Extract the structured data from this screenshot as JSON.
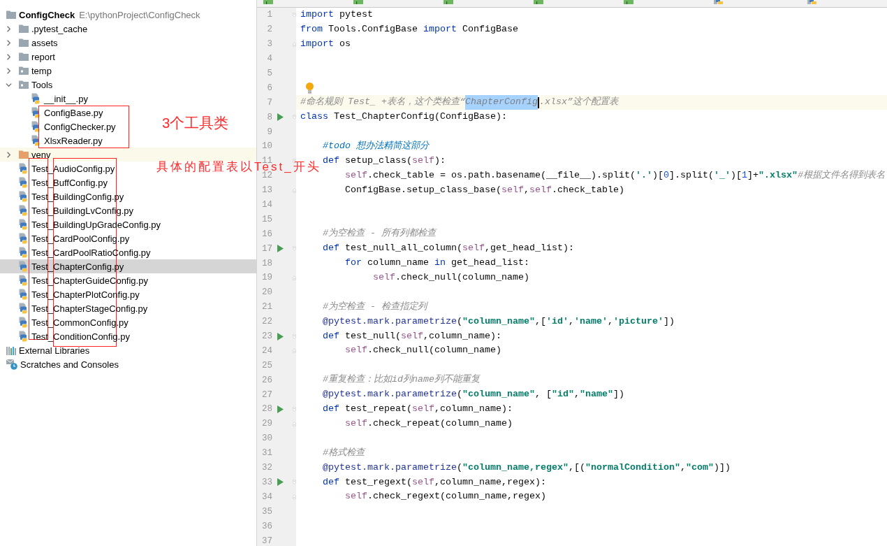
{
  "editor_tabs": [
    {
      "kind": "html"
    },
    {
      "kind": "html"
    },
    {
      "kind": "html"
    },
    {
      "kind": "html"
    },
    {
      "kind": "html"
    },
    {
      "kind": "python"
    },
    {
      "kind": "python"
    }
  ],
  "project_tree": {
    "items": [
      {
        "kind": "project-folder",
        "label": "ConfigCheck",
        "path": "E:\\pythonProject\\ConfigCheck",
        "selected": false,
        "children": [
          {
            "kind": "folder",
            "label": ".pytest_cache",
            "expanded": false,
            "selected": false
          },
          {
            "kind": "folder",
            "label": "assets",
            "expanded": false,
            "selected": false
          },
          {
            "kind": "folder",
            "label": "report",
            "expanded": false,
            "selected": false
          },
          {
            "kind": "package",
            "label": "temp",
            "expanded": false,
            "selected": false
          },
          {
            "kind": "package",
            "label": "Tools",
            "expanded": true,
            "selected": false,
            "children": [
              {
                "kind": "python",
                "label": "__init__.py",
                "selected": false
              },
              {
                "kind": "python",
                "label": "ConfigBase.py",
                "selected": false
              },
              {
                "kind": "python",
                "label": "ConfigChecker.py",
                "selected": false
              },
              {
                "kind": "python",
                "label": "XlsxReader.py",
                "selected": false
              }
            ]
          },
          {
            "kind": "excluded-folder",
            "label": "venv",
            "expanded": false,
            "selected": false
          },
          {
            "kind": "python",
            "label": "Test_AudioConfig.py",
            "selected": false
          },
          {
            "kind": "python",
            "label": "Test_BuffConfig.py",
            "selected": false
          },
          {
            "kind": "python",
            "label": "Test_BuildingConfig.py",
            "selected": false
          },
          {
            "kind": "python",
            "label": "Test_BuildingLvConfig.py",
            "selected": false
          },
          {
            "kind": "python",
            "label": "Test_BuildingUpGradeConfig.py",
            "selected": false
          },
          {
            "kind": "python",
            "label": "Test_CardPoolConfig.py",
            "selected": false
          },
          {
            "kind": "python",
            "label": "Test_CardPoolRatioConfig.py",
            "selected": false
          },
          {
            "kind": "python",
            "label": "Test_ChapterConfig.py",
            "selected": true
          },
          {
            "kind": "python",
            "label": "Test_ChapterGuideConfig.py",
            "selected": false
          },
          {
            "kind": "python",
            "label": "Test_ChapterPlotConfig.py",
            "selected": false
          },
          {
            "kind": "python",
            "label": "Test_ChapterStageConfig.py",
            "selected": false
          },
          {
            "kind": "python",
            "label": "Test_CommonConfig.py",
            "selected": false
          },
          {
            "kind": "python",
            "label": "Test_ConditionConfig.py",
            "selected": false
          }
        ]
      },
      {
        "kind": "library",
        "label": "External Libraries",
        "selected": false
      },
      {
        "kind": "scratches",
        "label": "Scratches and Consoles",
        "selected": false
      }
    ]
  },
  "editor": {
    "lines": [
      {
        "number": "1",
        "run": false,
        "current": false,
        "bulb": false,
        "fold": {
          "kind": "start"
        },
        "segments": [
          {
            "kind": "keyword",
            "text": "import"
          },
          {
            "kind": "plain",
            "text": " pytest"
          }
        ]
      },
      {
        "number": "2",
        "run": false,
        "current": false,
        "bulb": false,
        "segments": [
          {
            "kind": "keyword",
            "text": "from"
          },
          {
            "kind": "plain",
            "text": " Tools.ConfigBase "
          },
          {
            "kind": "keyword",
            "text": "import"
          },
          {
            "kind": "plain",
            "text": " ConfigBase"
          }
        ]
      },
      {
        "number": "3",
        "run": false,
        "current": false,
        "bulb": false,
        "fold": {
          "kind": "end"
        },
        "segments": [
          {
            "kind": "keyword",
            "text": "import"
          },
          {
            "kind": "plain",
            "text": " os"
          }
        ]
      },
      {
        "number": "4",
        "run": false,
        "current": false,
        "bulb": false
      },
      {
        "number": "5",
        "run": false,
        "current": false,
        "bulb": false
      },
      {
        "number": "6",
        "run": false,
        "current": false,
        "bulb": true
      },
      {
        "number": "7",
        "run": false,
        "current": true,
        "bulb": false,
        "segments": [
          {
            "kind": "comment",
            "text": "#命名规则 Test_ +表名，这个类检查“"
          },
          {
            "kind": "selection",
            "text": "ChapterConfig"
          },
          {
            "kind": "caret"
          },
          {
            "kind": "comment",
            "text": ".xlsx”这个配置表"
          }
        ]
      },
      {
        "number": "8",
        "run": true,
        "current": false,
        "bulb": false,
        "fold": {
          "kind": "start"
        },
        "segments": [
          {
            "kind": "keyword",
            "text": "class"
          },
          {
            "kind": "plain",
            "text": " Test_ChapterConfig(ConfigBase):"
          }
        ]
      },
      {
        "number": "9",
        "run": false,
        "current": false,
        "bulb": false
      },
      {
        "number": "10",
        "run": false,
        "current": false,
        "bulb": false,
        "segments": [
          {
            "kind": "todo",
            "text": "    #todo 想办法精简这部分"
          }
        ]
      },
      {
        "number": "11",
        "run": false,
        "current": false,
        "bulb": false,
        "fold": {
          "kind": "start"
        },
        "segments": [
          {
            "kind": "keyword",
            "text": "    def"
          },
          {
            "kind": "plain",
            "text": " setup_class("
          },
          {
            "kind": "self",
            "text": "self"
          },
          {
            "kind": "plain",
            "text": "):"
          }
        ]
      },
      {
        "number": "12",
        "run": false,
        "current": false,
        "bulb": false,
        "segments": [
          {
            "kind": "self",
            "text": "        self"
          },
          {
            "kind": "plain",
            "text": ".check_table = os.path.basename(__file__).split("
          },
          {
            "kind": "string",
            "text": "'.'"
          },
          {
            "kind": "plain",
            "text": ")["
          },
          {
            "kind": "number",
            "text": "0"
          },
          {
            "kind": "plain",
            "text": "].split("
          },
          {
            "kind": "string",
            "text": "'_'"
          },
          {
            "kind": "plain",
            "text": ")["
          },
          {
            "kind": "number",
            "text": "1"
          },
          {
            "kind": "plain",
            "text": "]+"
          },
          {
            "kind": "string",
            "text": "\".xlsx\""
          },
          {
            "kind": "comment",
            "text": "#根据文件名得到表名"
          }
        ]
      },
      {
        "number": "13",
        "run": false,
        "current": false,
        "bulb": false,
        "fold": {
          "kind": "end"
        },
        "segments": [
          {
            "kind": "plain",
            "text": "        ConfigBase.setup_class_base("
          },
          {
            "kind": "self",
            "text": "self"
          },
          {
            "kind": "plain",
            "text": ","
          },
          {
            "kind": "self",
            "text": "self"
          },
          {
            "kind": "plain",
            "text": ".check_table)"
          }
        ]
      },
      {
        "number": "14",
        "run": false,
        "current": false,
        "bulb": false
      },
      {
        "number": "15",
        "run": false,
        "current": false,
        "bulb": false
      },
      {
        "number": "16",
        "run": false,
        "current": false,
        "bulb": false,
        "segments": [
          {
            "kind": "comment",
            "text": "    #为空检查 - 所有列都检查"
          }
        ]
      },
      {
        "number": "17",
        "run": true,
        "current": false,
        "bulb": false,
        "fold": {
          "kind": "start"
        },
        "segments": [
          {
            "kind": "keyword",
            "text": "    def"
          },
          {
            "kind": "plain",
            "text": " test_null_all_column("
          },
          {
            "kind": "self",
            "text": "self"
          },
          {
            "kind": "plain",
            "text": ",get_head_list):"
          }
        ]
      },
      {
        "number": "18",
        "run": false,
        "current": false,
        "bulb": false,
        "segments": [
          {
            "kind": "keyword",
            "text": "        for"
          },
          {
            "kind": "plain",
            "text": " column_name "
          },
          {
            "kind": "keyword",
            "text": "in"
          },
          {
            "kind": "plain",
            "text": " get_head_list:"
          }
        ]
      },
      {
        "number": "19",
        "run": false,
        "current": false,
        "bulb": false,
        "fold": {
          "kind": "end"
        },
        "segments": [
          {
            "kind": "self",
            "text": "             self"
          },
          {
            "kind": "plain",
            "text": ".check_null(column_name)"
          }
        ]
      },
      {
        "number": "20",
        "run": false,
        "current": false,
        "bulb": false
      },
      {
        "number": "21",
        "run": false,
        "current": false,
        "bulb": false,
        "segments": [
          {
            "kind": "comment",
            "text": "    #为空检查 - 检查指定列"
          }
        ]
      },
      {
        "number": "22",
        "run": false,
        "current": false,
        "bulb": false,
        "segments": [
          {
            "kind": "decorator",
            "text": "    @pytest.mark.parametrize"
          },
          {
            "kind": "plain",
            "text": "("
          },
          {
            "kind": "string",
            "text": "\"column_name\""
          },
          {
            "kind": "plain",
            "text": ",["
          },
          {
            "kind": "string",
            "text": "'id'"
          },
          {
            "kind": "plain",
            "text": ","
          },
          {
            "kind": "string",
            "text": "'name'"
          },
          {
            "kind": "plain",
            "text": ","
          },
          {
            "kind": "string",
            "text": "'picture'"
          },
          {
            "kind": "plain",
            "text": "])"
          }
        ]
      },
      {
        "number": "23",
        "run": true,
        "current": false,
        "bulb": false,
        "fold": {
          "kind": "start"
        },
        "segments": [
          {
            "kind": "keyword",
            "text": "    def"
          },
          {
            "kind": "plain",
            "text": " test_null("
          },
          {
            "kind": "self",
            "text": "self"
          },
          {
            "kind": "plain",
            "text": ",column_name):"
          }
        ]
      },
      {
        "number": "24",
        "run": false,
        "current": false,
        "bulb": false,
        "fold": {
          "kind": "end"
        },
        "segments": [
          {
            "kind": "self",
            "text": "        self"
          },
          {
            "kind": "plain",
            "text": ".check_null(column_name)"
          }
        ]
      },
      {
        "number": "25",
        "run": false,
        "current": false,
        "bulb": false
      },
      {
        "number": "26",
        "run": false,
        "current": false,
        "bulb": false,
        "segments": [
          {
            "kind": "comment",
            "text": "    #重复检查：比如id列name列不能重复"
          }
        ]
      },
      {
        "number": "27",
        "run": false,
        "current": false,
        "bulb": false,
        "segments": [
          {
            "kind": "decorator",
            "text": "    @pytest.mark.parametrize"
          },
          {
            "kind": "plain",
            "text": "("
          },
          {
            "kind": "string",
            "text": "\"column_name\""
          },
          {
            "kind": "plain",
            "text": ", ["
          },
          {
            "kind": "string",
            "text": "\"id\""
          },
          {
            "kind": "plain",
            "text": ","
          },
          {
            "kind": "string",
            "text": "\"name\""
          },
          {
            "kind": "plain",
            "text": "])"
          }
        ]
      },
      {
        "number": "28",
        "run": true,
        "current": false,
        "bulb": false,
        "fold": {
          "kind": "start"
        },
        "segments": [
          {
            "kind": "keyword",
            "text": "    def"
          },
          {
            "kind": "plain",
            "text": " test_repeat("
          },
          {
            "kind": "self",
            "text": "self"
          },
          {
            "kind": "plain",
            "text": ",column_name):"
          }
        ]
      },
      {
        "number": "29",
        "run": false,
        "current": false,
        "bulb": false,
        "fold": {
          "kind": "end"
        },
        "segments": [
          {
            "kind": "self",
            "text": "        self"
          },
          {
            "kind": "plain",
            "text": ".check_repeat(column_name)"
          }
        ]
      },
      {
        "number": "30",
        "run": false,
        "current": false,
        "bulb": false
      },
      {
        "number": "31",
        "run": false,
        "current": false,
        "bulb": false,
        "segments": [
          {
            "kind": "comment",
            "text": "    #格式检查"
          }
        ]
      },
      {
        "number": "32",
        "run": false,
        "current": false,
        "bulb": false,
        "segments": [
          {
            "kind": "decorator",
            "text": "    @pytest.mark.parametrize"
          },
          {
            "kind": "plain",
            "text": "("
          },
          {
            "kind": "string",
            "text": "\"column_name,regex\""
          },
          {
            "kind": "plain",
            "text": ",[("
          },
          {
            "kind": "string",
            "text": "\"normalCondition\""
          },
          {
            "kind": "plain",
            "text": ","
          },
          {
            "kind": "string",
            "text": "\"com\""
          },
          {
            "kind": "plain",
            "text": ")])"
          }
        ]
      },
      {
        "number": "33",
        "run": true,
        "current": false,
        "bulb": false,
        "fold": {
          "kind": "start"
        },
        "segments": [
          {
            "kind": "keyword",
            "text": "    def"
          },
          {
            "kind": "plain",
            "text": " test_regext("
          },
          {
            "kind": "self",
            "text": "self"
          },
          {
            "kind": "plain",
            "text": ",column_name,regex):"
          }
        ]
      },
      {
        "number": "34",
        "run": false,
        "current": false,
        "bulb": false,
        "fold": {
          "kind": "end"
        },
        "segments": [
          {
            "kind": "self",
            "text": "        self"
          },
          {
            "kind": "plain",
            "text": ".check_regext(column_name,regex)"
          }
        ]
      },
      {
        "number": "35",
        "run": false,
        "current": false,
        "bulb": false
      },
      {
        "number": "36",
        "run": false,
        "current": false,
        "bulb": false
      },
      {
        "number": "37",
        "run": false,
        "current": false,
        "bulb": false
      }
    ]
  },
  "annotations": [
    {
      "text": "3个工具类"
    },
    {
      "text": "具体的配置表以Test_开头"
    }
  ]
}
